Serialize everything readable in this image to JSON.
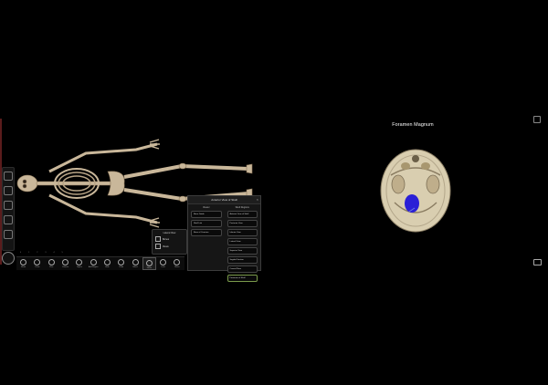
{
  "left_app": {
    "view_box": {
      "title": "Lateral View",
      "rows": [
        "Bones",
        "Views"
      ]
    },
    "panel": {
      "title": "Anterior View of Skull",
      "close_icon": "close-icon",
      "col_left_header": "Viewer",
      "col_right_header": "Skull Regions",
      "left_items": [
        "Bone Guide",
        "Skull Lab",
        "Base of Cranium"
      ],
      "right_items": [
        "Anterior View of Skull",
        "Posterior View",
        "Inferior View",
        "Lateral View",
        "Superior View",
        "Sagittal Section",
        "Cranial Floor",
        "Foramina of Skull"
      ]
    },
    "bottom_toolbar": [
      {
        "label": "Menu",
        "icon": "grid-icon"
      },
      {
        "label": "Draw",
        "icon": "pen-icon"
      },
      {
        "label": "Pins",
        "icon": "pin-icon"
      },
      {
        "label": "Camera",
        "icon": "camera-icon"
      },
      {
        "label": "Layers",
        "icon": "layers-icon"
      },
      {
        "label": "Add Region",
        "icon": "person-icon"
      },
      {
        "label": "Hide",
        "icon": "hide-icon"
      },
      {
        "label": "Undo",
        "icon": "undo-icon"
      },
      {
        "label": "Select",
        "icon": "select-icon"
      },
      {
        "label": "Views",
        "icon": "views-icon"
      },
      {
        "label": "Lock",
        "icon": "lock-icon"
      },
      {
        "label": "Share",
        "icon": "share-icon"
      }
    ],
    "ruler_ticks": [
      "0",
      "1",
      "2",
      "3",
      "4",
      "5"
    ]
  },
  "right_view": {
    "title": "Foramen Magnum",
    "highlight_color": "#2a1fd6",
    "bone_color": "#d9ceb0"
  }
}
